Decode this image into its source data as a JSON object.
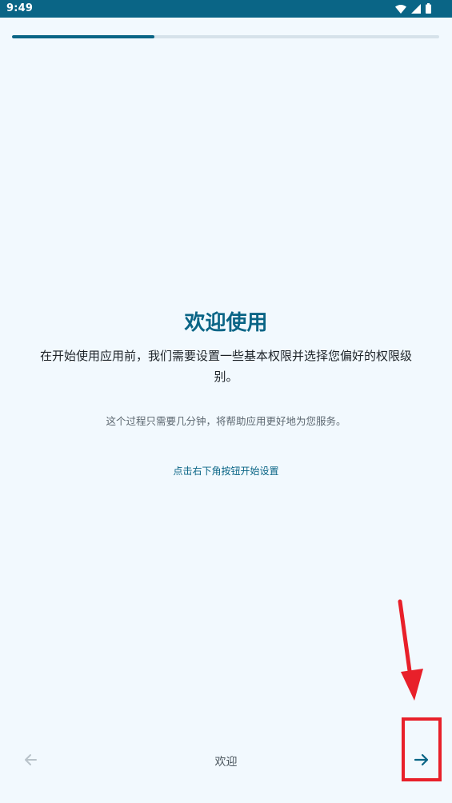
{
  "status_bar": {
    "time": "9:49",
    "icons": [
      "wifi-icon",
      "cellular-signal-icon",
      "battery-icon"
    ],
    "color": "#0a6586"
  },
  "progress": {
    "fraction": 0.333
  },
  "welcome": {
    "title": "欢迎使用",
    "intro": "在开始使用应用前，我们需要设置一些基本权限并选择您偏好的权限级别。",
    "note": "这个过程只需要几分钟，将帮助应用更好地为您服务。",
    "hint": "点击右下角按钮开始设置"
  },
  "bottom_nav": {
    "back_icon": "arrow-left-icon",
    "step_label": "欢迎",
    "next_icon": "arrow-right-icon"
  },
  "colors": {
    "accent": "#0a6586",
    "background": "#f2f9fe",
    "annotation": "#e8202a"
  }
}
